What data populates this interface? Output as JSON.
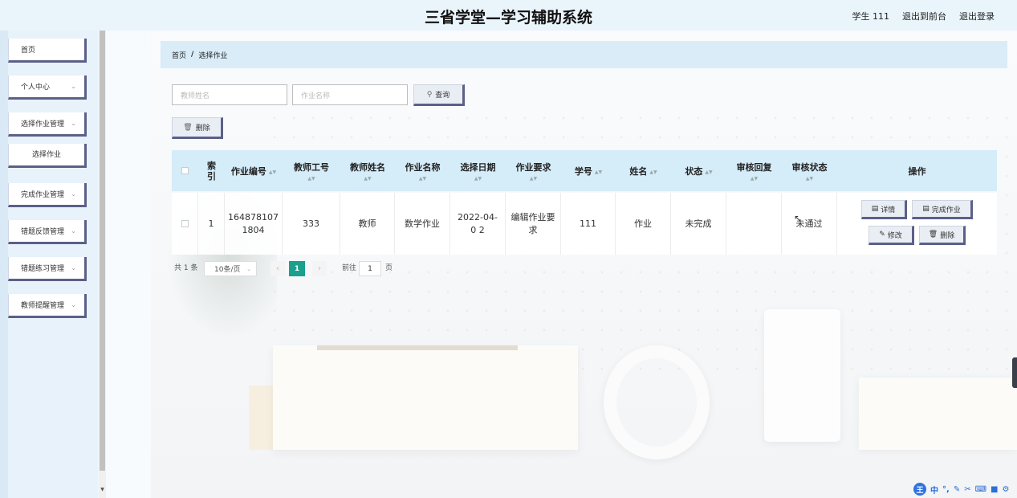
{
  "header": {
    "title": "三省学堂—学习辅助系统",
    "user": "学生 111",
    "to_front": "退出到前台",
    "logout": "退出登录"
  },
  "sidebar": {
    "items": [
      {
        "label": "首页"
      },
      {
        "label": "个人中心"
      },
      {
        "label": "选择作业管理"
      },
      {
        "label": "选择作业"
      },
      {
        "label": "完成作业管理"
      },
      {
        "label": "错题反馈管理"
      },
      {
        "label": "错题练习管理"
      },
      {
        "label": "教师提醒管理"
      }
    ]
  },
  "breadcrumb": {
    "home": "首页",
    "sep": "/",
    "current": "选择作业"
  },
  "search": {
    "teacher_name_placeholder": "教师姓名",
    "assignment_name_placeholder": "作业名称",
    "query_label": "查询",
    "delete_label": "删除"
  },
  "table": {
    "headers": {
      "index": "索引",
      "assignment_no": "作业编号",
      "teacher_id": "教师工号",
      "teacher_name": "教师姓名",
      "assignment_name": "作业名称",
      "select_date": "选择日期",
      "requirement": "作业要求",
      "student_no": "学号",
      "name": "姓名",
      "status": "状态",
      "review_reply": "审核回复",
      "review_status": "审核状态",
      "actions": "操作"
    },
    "rows": [
      {
        "index": "1",
        "assignment_no": "164878107 1804",
        "teacher_id": "333",
        "teacher_name": "教师",
        "assignment_name": "数学作业",
        "select_date": "2022-04-0 2",
        "requirement": "编辑作业要 求",
        "student_no": "111",
        "name": "作业",
        "status": "未完成",
        "review_reply": "",
        "review_status": "未通过",
        "actions": {
          "detail": "详情",
          "complete": "完成作业",
          "edit": "修改",
          "delete": "删除"
        }
      }
    ]
  },
  "pagination": {
    "total": "共 1 条",
    "page_size": "10条/页",
    "current_page": "1",
    "goto_label": "前往",
    "goto_value": "1",
    "page_unit": "页"
  },
  "ime": {
    "logo": "王",
    "lang": "中"
  },
  "colors": {
    "accent": "#1aa08c",
    "header_bg": "#d5ecf9",
    "button_border": "#5b6088"
  }
}
